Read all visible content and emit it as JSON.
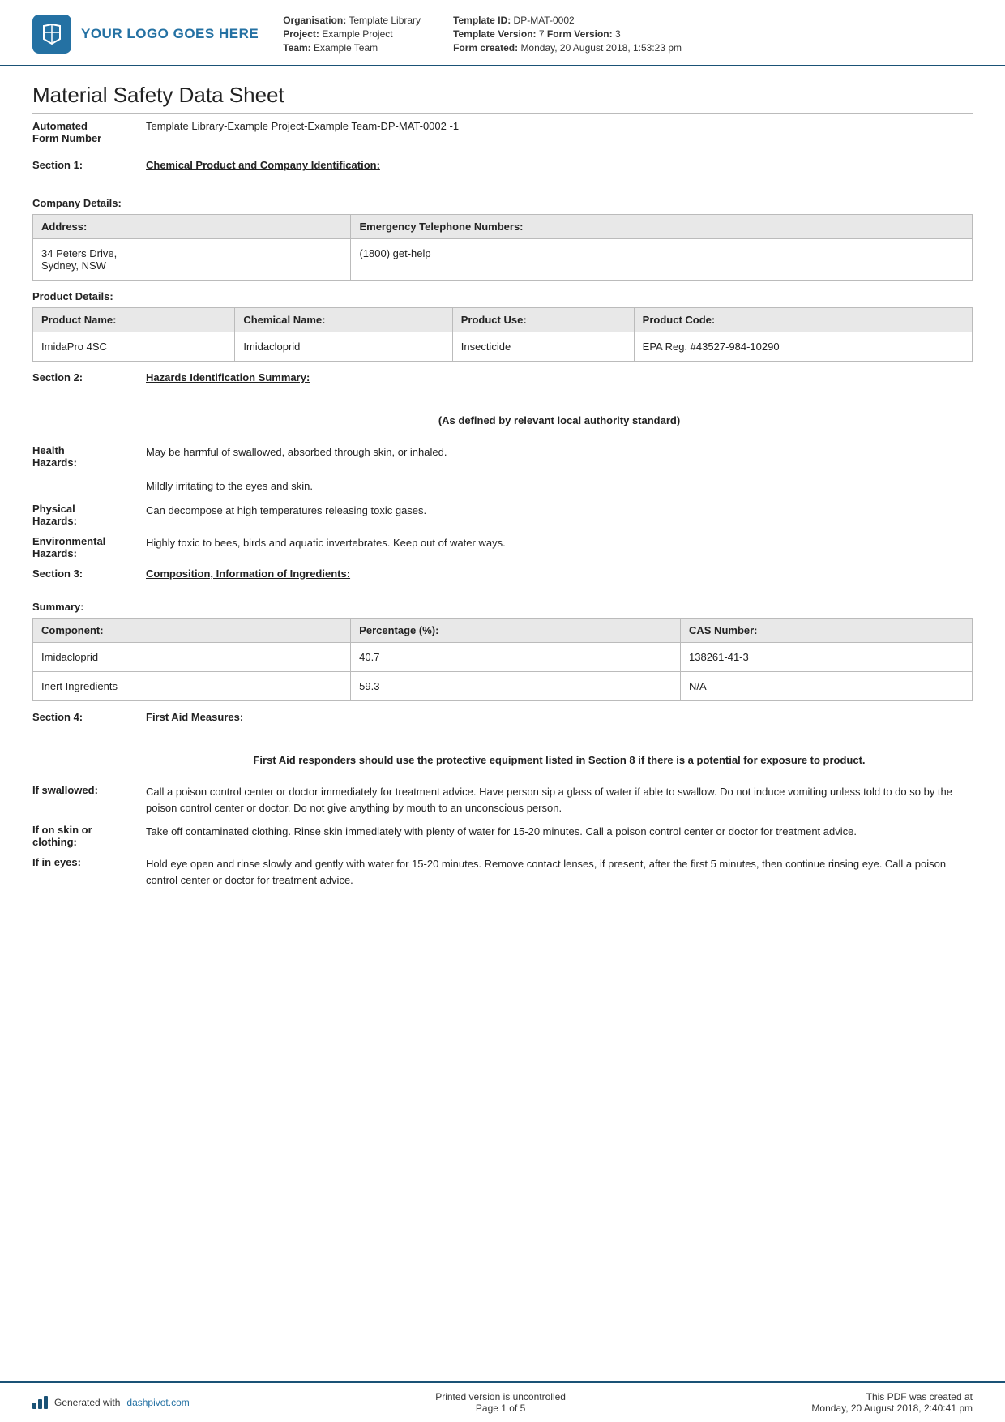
{
  "header": {
    "logo_text": "YOUR LOGO GOES HERE",
    "org_label": "Organisation:",
    "org_value": "Template Library",
    "project_label": "Project:",
    "project_value": "Example Project",
    "team_label": "Team:",
    "team_value": "Example Team",
    "template_id_label": "Template ID:",
    "template_id_value": "DP-MAT-0002",
    "template_version_label": "Template Version:",
    "template_version_value": "7",
    "form_version_label": "Form Version:",
    "form_version_value": "3",
    "form_created_label": "Form created:",
    "form_created_value": "Monday, 20 August 2018, 1:53:23 pm"
  },
  "document": {
    "title": "Material Safety Data Sheet",
    "form_number_label": "Automated\nForm Number",
    "form_number_value": "Template Library-Example Project-Example Team-DP-MAT-0002  -1"
  },
  "section1": {
    "num": "Section 1:",
    "title": "Chemical Product and Company Identification:",
    "company_details_label": "Company Details:",
    "company_table": {
      "headers": [
        "Address:",
        "Emergency Telephone Numbers:"
      ],
      "row": {
        "address": "34 Peters Drive,\nSydney, NSW",
        "phone": "(1800) get-help"
      }
    },
    "product_details_label": "Product Details:",
    "product_table": {
      "headers": [
        "Product Name:",
        "Chemical Name:",
        "Product Use:",
        "Product Code:"
      ],
      "row": {
        "product_name": "ImidaPro 4SC",
        "chemical_name": "Imidacloprid",
        "product_use": "Insecticide",
        "product_code": "EPA Reg. #43527-984-10290"
      }
    }
  },
  "section2": {
    "num": "Section 2:",
    "title": "Hazards Identification Summary:",
    "note": "(As defined by relevant local authority standard)",
    "health_label": "Health\nHazards:",
    "health_value1": "May be harmful of swallowed, absorbed through skin, or inhaled.",
    "health_value2": "Mildly irritating to the eyes and skin.",
    "physical_label": "Physical\nHazards:",
    "physical_value": "Can decompose at high temperatures releasing toxic gases.",
    "environmental_label": "Environmental\nHazards:",
    "environmental_value": "Highly toxic to bees, birds and aquatic invertebrates. Keep out of water ways."
  },
  "section3": {
    "num": "Section 3:",
    "title": "Composition, Information of Ingredients:",
    "summary_label": "Summary:",
    "ingredients_table": {
      "headers": [
        "Component:",
        "Percentage (%):",
        "CAS Number:"
      ],
      "rows": [
        {
          "component": "Imidacloprid",
          "percentage": "40.7",
          "cas": "138261-41-3"
        },
        {
          "component": "Inert Ingredients",
          "percentage": "59.3",
          "cas": "N/A"
        }
      ]
    }
  },
  "section4": {
    "num": "Section 4:",
    "title": "First Aid Measures:",
    "note": "First Aid responders should use the protective equipment listed in Section 8 if there is a potential for exposure to product.",
    "swallowed_label": "If swallowed:",
    "swallowed_value": "Call a poison control center or doctor immediately for treatment advice. Have person sip a glass of water if able to swallow. Do not induce vomiting unless told to do so by the poison control center or doctor. Do not give anything by mouth to an unconscious person.",
    "skin_label": "If on skin or\nclothing:",
    "skin_value": "Take off contaminated clothing. Rinse skin immediately with plenty of water for 15-20 minutes. Call a poison control center or doctor for treatment advice.",
    "eyes_label": "If in eyes:",
    "eyes_value": "Hold eye open and rinse slowly and gently with water for 15-20 minutes. Remove contact lenses, if present, after the first 5 minutes, then continue rinsing eye. Call a poison control center or doctor for treatment advice."
  },
  "footer": {
    "generated_label": "Generated with",
    "generated_link": "dashpivot.com",
    "printed_label": "Printed version is uncontrolled",
    "page_label": "Page 1 of 5",
    "pdf_label": "This PDF was created at",
    "pdf_value": "Monday, 20 August 2018, 2:40:41 pm"
  }
}
